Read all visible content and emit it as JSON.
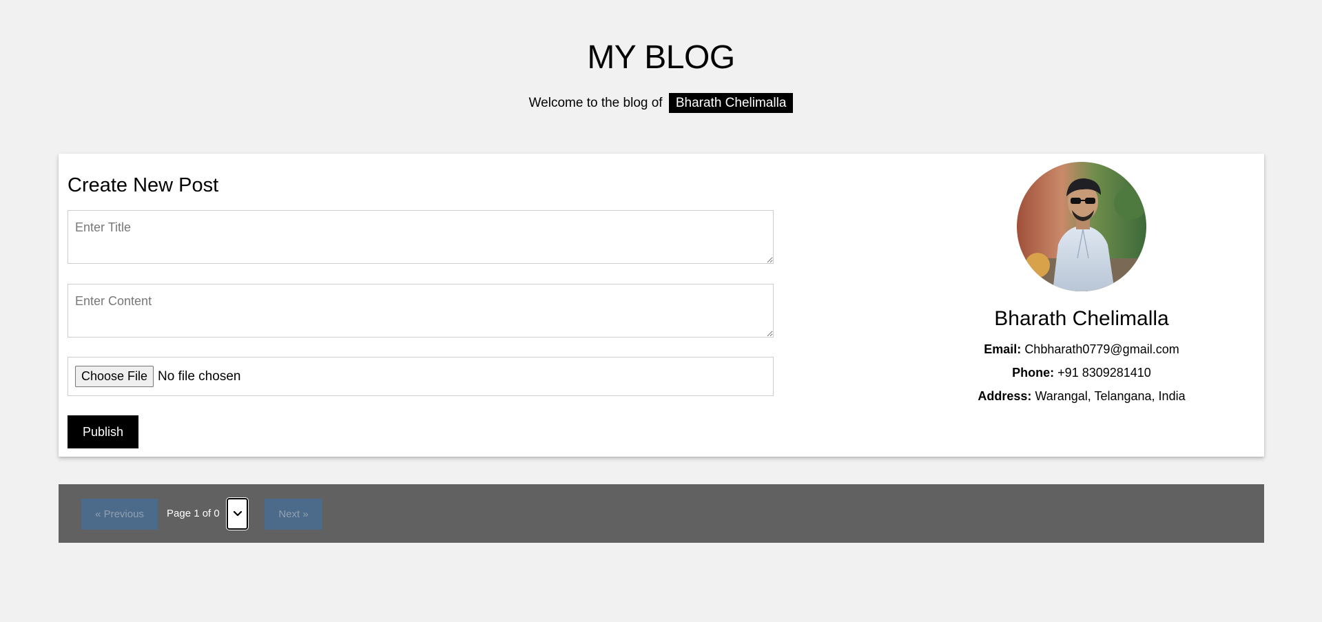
{
  "header": {
    "title": "MY BLOG",
    "welcome_text": "Welcome to the blog of",
    "owner_name": "Bharath Chelimalla"
  },
  "create_post": {
    "heading": "Create New Post",
    "title_placeholder": "Enter Title",
    "content_placeholder": "Enter Content",
    "file_button_label": "Choose File",
    "file_status": "No file chosen",
    "publish_label": "Publish"
  },
  "profile": {
    "name": "Bharath Chelimalla",
    "email_label": "Email:",
    "email": "Chbharath0779@gmail.com",
    "phone_label": "Phone:",
    "phone": "+91 8309281410",
    "address_label": "Address:",
    "address": "Warangal, Telangana, India"
  },
  "pagination": {
    "prev_label": "« Previous",
    "page_info": "Page 1 of 0",
    "next_label": "Next »"
  },
  "colors": {
    "background": "#f1f1f1",
    "card": "#ffffff",
    "primary_button": "#000000",
    "pager_bar": "#616161",
    "pager_button": "#4c6b8a"
  }
}
